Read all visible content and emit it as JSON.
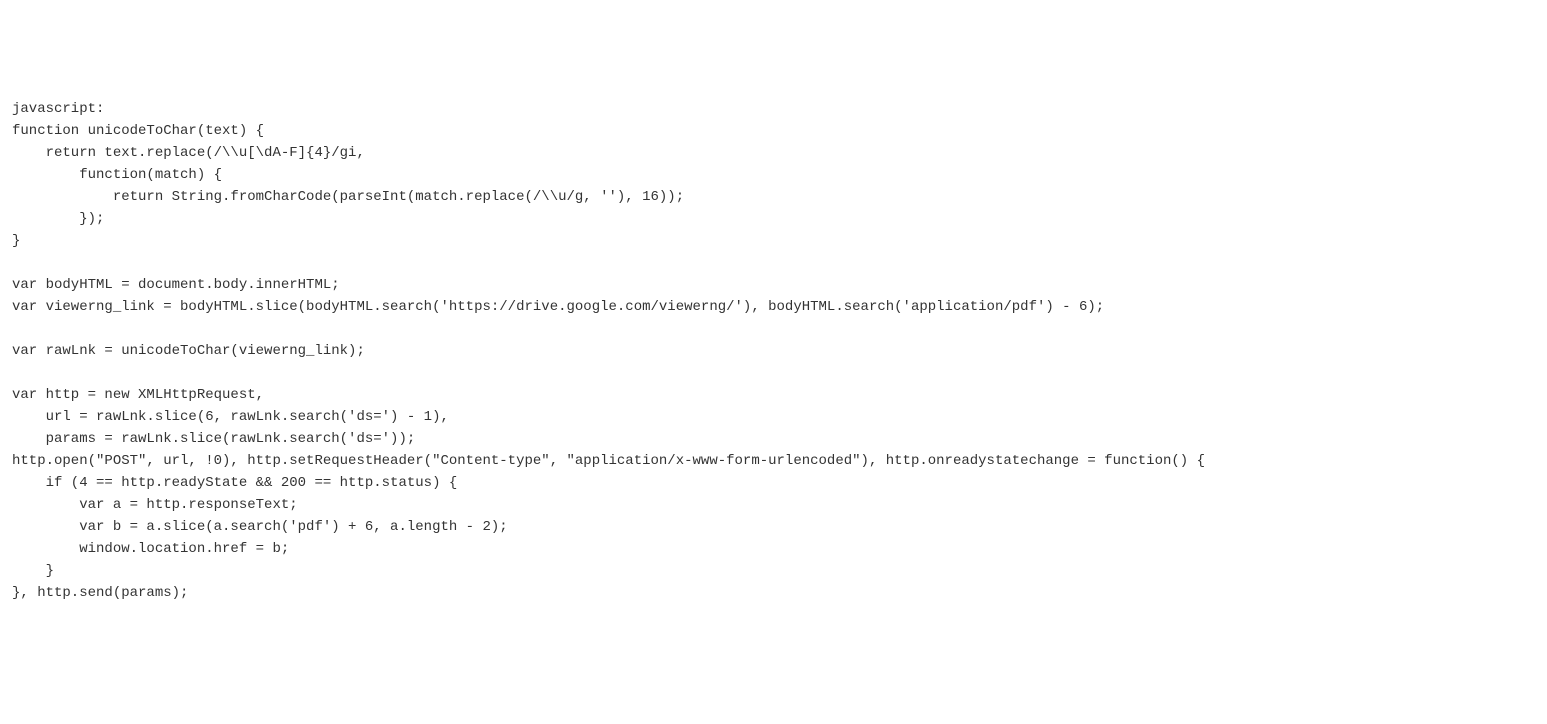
{
  "code": {
    "lines": [
      "javascript:",
      "function unicodeToChar(text) {",
      "    return text.replace(/\\\\u[\\dA-F]{4}/gi,",
      "        function(match) {",
      "            return String.fromCharCode(parseInt(match.replace(/\\\\u/g, ''), 16));",
      "        });",
      "}",
      "",
      "var bodyHTML = document.body.innerHTML;",
      "var viewerng_link = bodyHTML.slice(bodyHTML.search('https://drive.google.com/viewerng/'), bodyHTML.search('application/pdf') - 6);",
      "",
      "var rawLnk = unicodeToChar(viewerng_link);",
      "",
      "var http = new XMLHttpRequest,",
      "    url = rawLnk.slice(6, rawLnk.search('ds=') - 1),",
      "    params = rawLnk.slice(rawLnk.search('ds='));",
      "http.open(\"POST\", url, !0), http.setRequestHeader(\"Content-type\", \"application/x-www-form-urlencoded\"), http.onreadystatechange = function() {",
      "    if (4 == http.readyState && 200 == http.status) {",
      "        var a = http.responseText;",
      "        var b = a.slice(a.search('pdf') + 6, a.length - 2);",
      "        window.location.href = b;",
      "    }",
      "}, http.send(params);"
    ]
  }
}
